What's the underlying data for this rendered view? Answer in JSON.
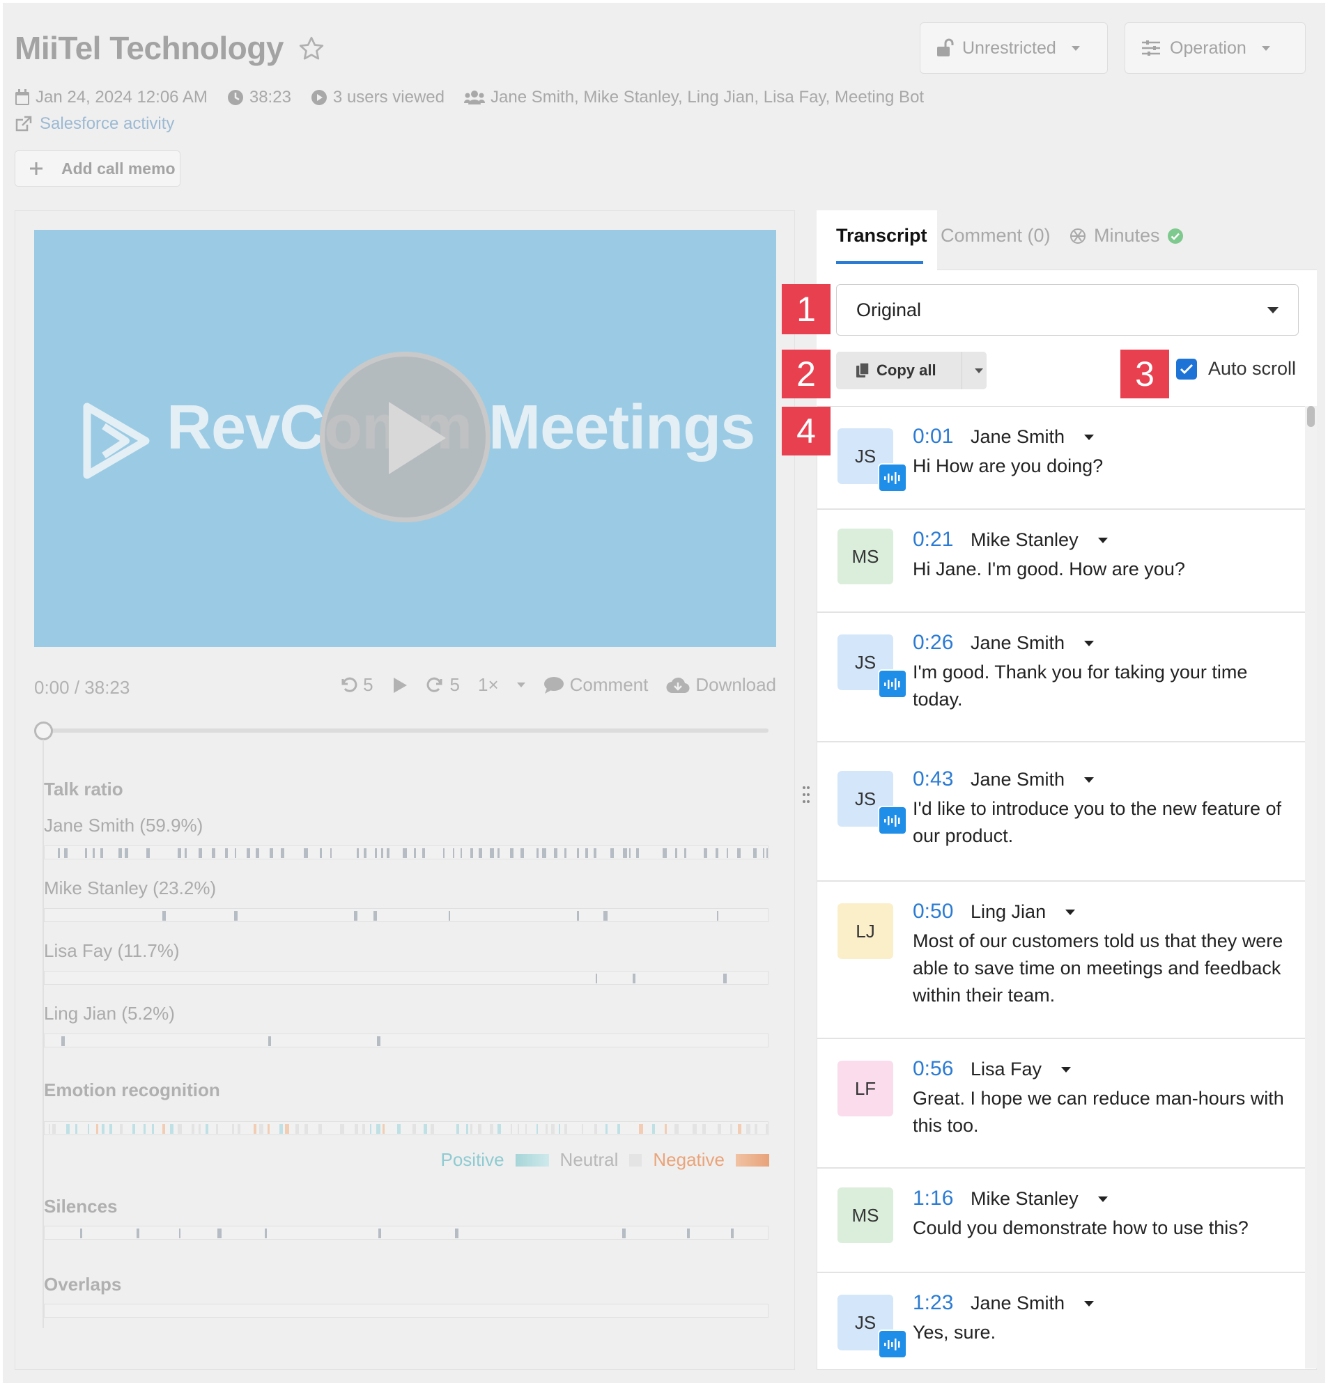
{
  "header": {
    "title": "MiiTel Technology",
    "unrestricted_label": "Unrestricted",
    "operation_label": "Operation"
  },
  "meta": {
    "datetime": "Jan 24, 2024 12:06 AM",
    "duration": "38:23",
    "views": "3 users viewed",
    "participants": "Jane Smith, Mike Stanley, Ling Jian, Lisa Fay, Meeting Bot",
    "salesforce_link": "Salesforce activity",
    "add_memo": "Add call memo"
  },
  "video": {
    "logo_text": "RevComm Meetings"
  },
  "controls": {
    "time": "0:00 / 38:23",
    "rewind": "5",
    "forward": "5",
    "speed": "1×",
    "comment": "Comment",
    "download": "Download",
    "position_fraction": 0
  },
  "analytics": {
    "talk_ratio_label": "Talk ratio",
    "speakers": [
      {
        "label": "Jane Smith (59.9%)",
        "ratio": 0.599
      },
      {
        "label": "Mike Stanley (23.2%)",
        "ratio": 0.232
      },
      {
        "label": "Lisa Fay (11.7%)",
        "ratio": 0.117
      },
      {
        "label": "Ling Jian (5.2%)",
        "ratio": 0.052
      }
    ],
    "emotion_label": "Emotion recognition",
    "legend": {
      "positive": "Positive",
      "neutral": "Neutral",
      "negative": "Negative"
    },
    "silences_label": "Silences",
    "overlaps_label": "Overlaps"
  },
  "colors": {
    "accent": "#2a7bd3",
    "badge": "#e9404f",
    "positive": "#8fd0d8",
    "neutral": "#e6e6e6",
    "negative": "#f0b28a",
    "video_bg": "#9bcbe4"
  },
  "tabs": {
    "transcript": "Transcript",
    "comment": "Comment",
    "comment_count": "(0)",
    "minutes": "Minutes"
  },
  "transcript": {
    "language": "Original",
    "copy_all": "Copy all",
    "auto_scroll": "Auto scroll",
    "auto_scroll_checked": true,
    "entries": [
      {
        "initials": "JS",
        "time": "0:01",
        "speaker": "Jane Smith",
        "text": "Hi How are you doing?",
        "voice_badge": true
      },
      {
        "initials": "MS",
        "time": "0:21",
        "speaker": "Mike Stanley",
        "text": "Hi Jane. I'm good. How are you?",
        "voice_badge": false
      },
      {
        "initials": "JS",
        "time": "0:26",
        "speaker": "Jane Smith",
        "text": "I'm good. Thank you for taking your time today.",
        "voice_badge": true
      },
      {
        "initials": "JS",
        "time": "0:43",
        "speaker": "Jane Smith",
        "text": "I'd like to introduce you to the new feature of our product.",
        "voice_badge": true
      },
      {
        "initials": "LJ",
        "time": "0:50",
        "speaker": "Ling Jian",
        "text": "Most of our customers told us that they were able to save time on meetings and feedback within their team.",
        "voice_badge": false
      },
      {
        "initials": "LF",
        "time": "0:56",
        "speaker": "Lisa Fay",
        "text": "Great. I hope we can reduce man-hours with this too.",
        "voice_badge": false
      },
      {
        "initials": "MS",
        "time": "1:16",
        "speaker": "Mike Stanley",
        "text": "Could you demonstrate how to use this?",
        "voice_badge": false
      },
      {
        "initials": "JS",
        "time": "1:23",
        "speaker": "Jane Smith",
        "text": "Yes, sure.",
        "voice_badge": true
      }
    ]
  },
  "annotations": [
    "1",
    "2",
    "3",
    "4"
  ]
}
